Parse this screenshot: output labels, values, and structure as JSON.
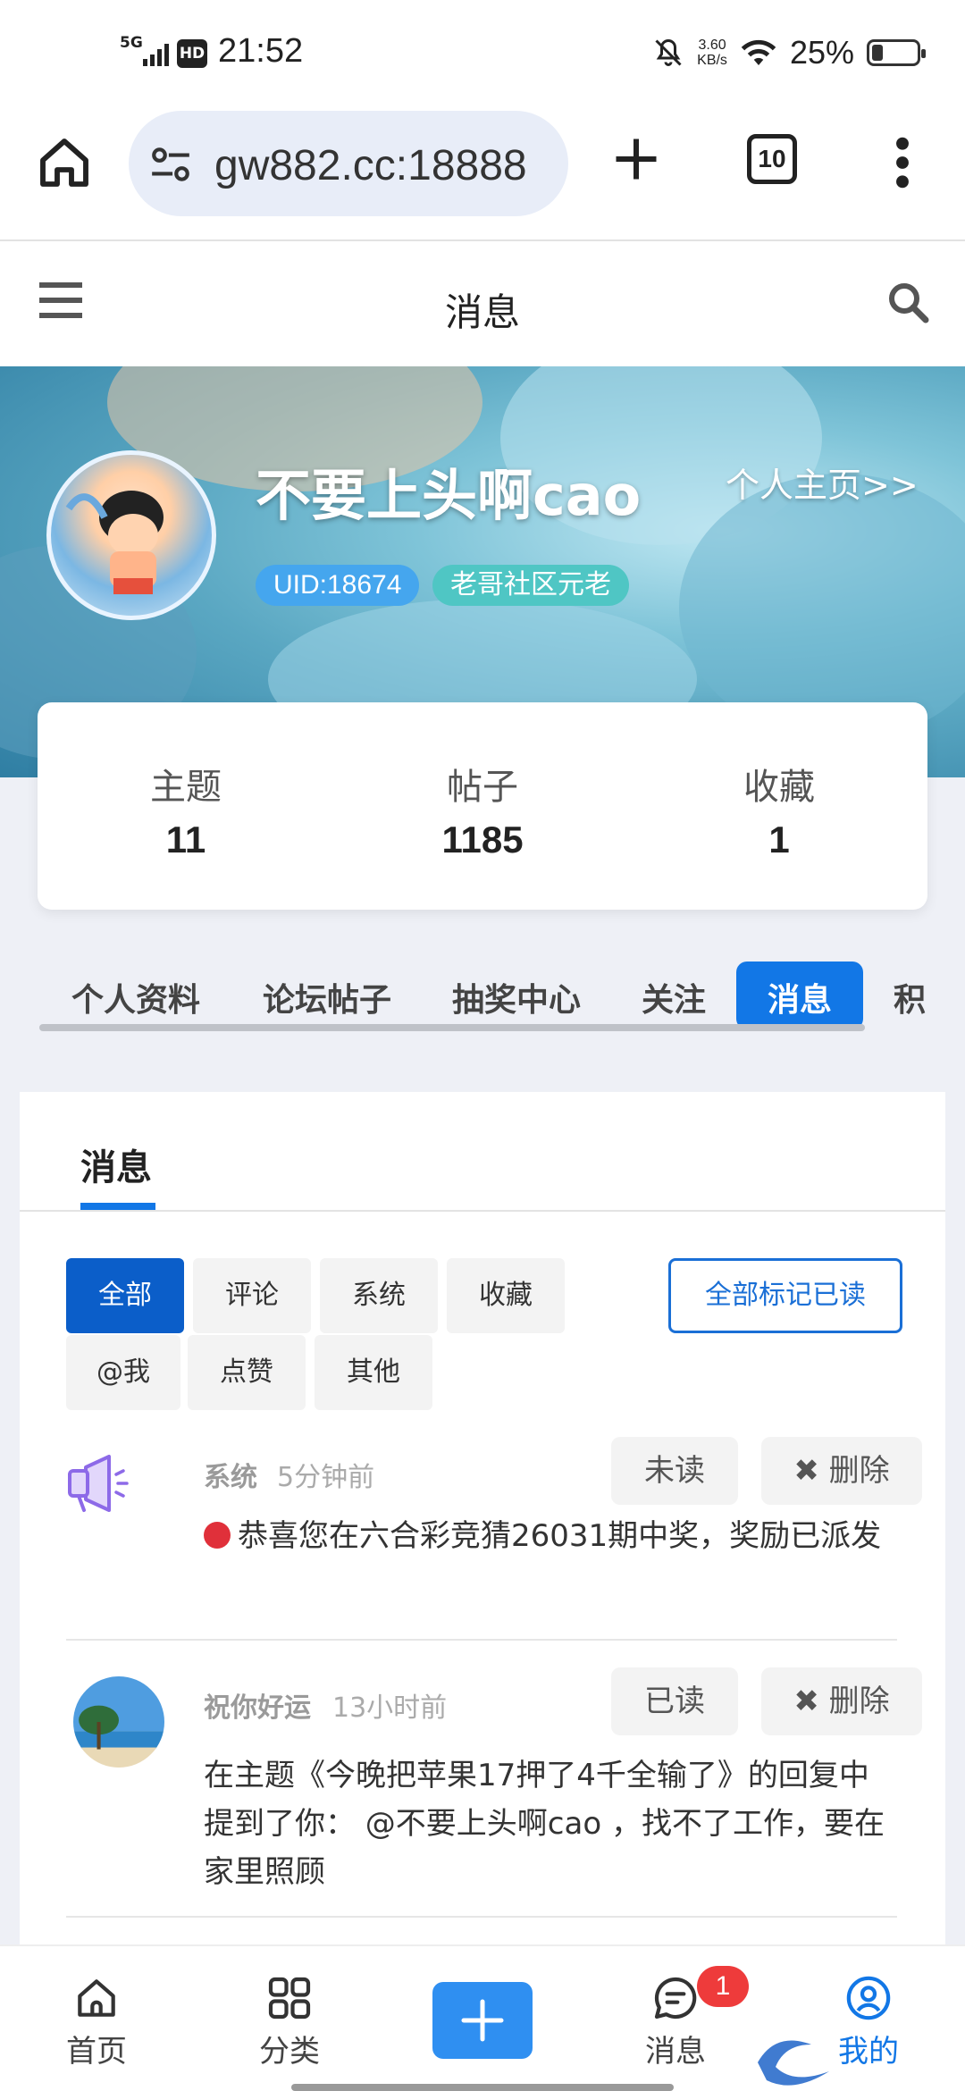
{
  "status_bar": {
    "network": "5G",
    "hd": "HD",
    "time": "21:52",
    "speed_value": "3.60",
    "speed_unit": "KB/s",
    "battery": "25%"
  },
  "browser": {
    "url": "gw882.cc:18888",
    "tab_count": "10"
  },
  "header": {
    "title": "消息"
  },
  "profile": {
    "username": "不要上头啊cao",
    "homepage_link": "个人主页>>",
    "uid": "UID:18674",
    "rank": "老哥社区元老"
  },
  "stats": [
    {
      "label": "主题",
      "value": "11"
    },
    {
      "label": "帖子",
      "value": "1185"
    },
    {
      "label": "收藏",
      "value": "1"
    }
  ],
  "tabs": [
    {
      "label": "个人资料"
    },
    {
      "label": "论坛帖子"
    },
    {
      "label": "抽奖中心"
    },
    {
      "label": "关注"
    },
    {
      "label": "消息",
      "active": true
    },
    {
      "label": "积"
    }
  ],
  "panel": {
    "title": "消息",
    "mark_all": "全部标记已读",
    "filters": [
      {
        "label": "全部",
        "active": true
      },
      {
        "label": "评论"
      },
      {
        "label": "系统"
      },
      {
        "label": "收藏"
      },
      {
        "label": "@我"
      },
      {
        "label": "点赞"
      },
      {
        "label": "其他"
      }
    ]
  },
  "messages": [
    {
      "sender": "系统",
      "time": "5分钟前",
      "status": "未读",
      "delete": "✖ 删除",
      "body": "恭喜您在六合彩竞猜26031期中奖，奖励已派发",
      "icon": "megaphone-icon"
    },
    {
      "sender": "祝你好运",
      "time": "13小时前",
      "status": "已读",
      "delete": "✖ 删除",
      "body": "在主题《今晚把苹果17押了4千全输了》的回复中提到了你： @不要上头啊cao ，找不了工作，要在家里照顾",
      "icon": "user-avatar"
    }
  ],
  "bottom_nav": [
    {
      "label": "首页",
      "icon": "home-icon"
    },
    {
      "label": "分类",
      "icon": "grid-icon"
    },
    {
      "label": "消息",
      "icon": "chat-icon",
      "badge": "1"
    },
    {
      "label": "我的",
      "icon": "user-circle-icon"
    }
  ],
  "colors": {
    "accent": "#1277e6",
    "badge_red": "#ee3b3b",
    "unread_dot": "#e0303a"
  }
}
